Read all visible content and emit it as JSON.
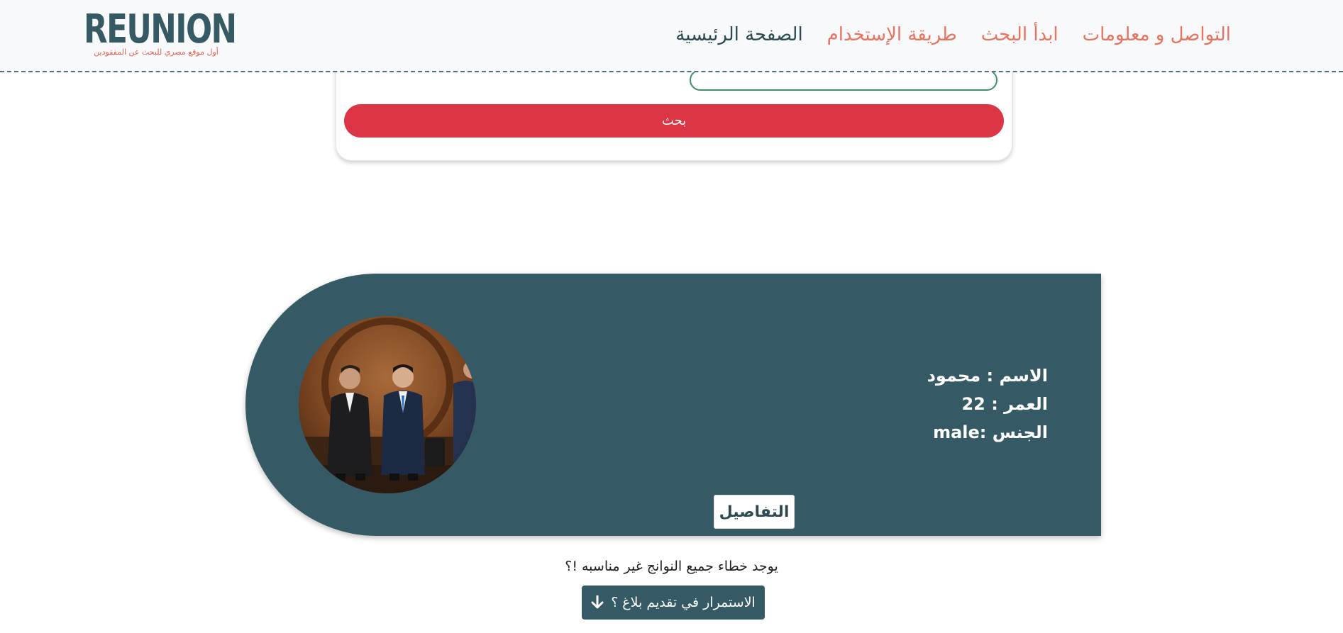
{
  "brand": {
    "name": "REUNION",
    "tagline": "أول موقع مصري للبحث عن المفقودين",
    "color": "#365a64",
    "tagline_color": "#e85d52"
  },
  "nav": {
    "items": [
      {
        "label": "الصفحة الرئيسية",
        "active": true
      },
      {
        "label": "طريقة الإستخدام",
        "active": false
      },
      {
        "label": "ابدأ البحث",
        "active": false
      },
      {
        "label": "التواصل و معلومات",
        "active": false
      }
    ]
  },
  "search": {
    "button_label": "بحث",
    "button_color": "#dc3545"
  },
  "result": {
    "card_color": "#355a65",
    "name_line": "الاسم : محمود",
    "age_line": "العمر : 22",
    "gender_line": "الجنس :male",
    "details_label": "التفاصيل",
    "photo_icon": "person-photo"
  },
  "footer": {
    "error_text": "يوجد خطاء جميع النوانج غير مناسبه !؟",
    "report_label": "الاستمرار في تقديم بلاغ ؟",
    "report_icon": "arrow-down-icon"
  }
}
